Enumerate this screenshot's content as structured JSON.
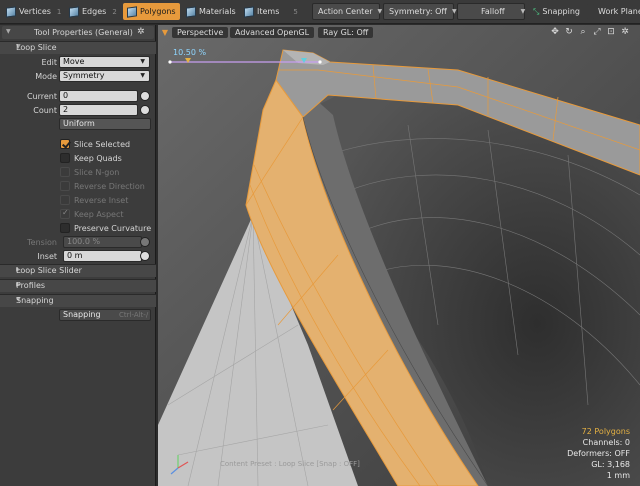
{
  "modes": [
    {
      "label": "Vertices",
      "num": "1"
    },
    {
      "label": "Edges",
      "num": "2"
    },
    {
      "label": "Polygons",
      "num": ""
    },
    {
      "label": "Materials",
      "num": ""
    },
    {
      "label": "Items",
      "num": "5"
    }
  ],
  "toolbar": {
    "action_center": "Action Center",
    "symmetry": "Symmetry: Off",
    "falloff": "Falloff",
    "snapping": "Snapping",
    "work_plane": "Work Plane"
  },
  "panel": {
    "title": "Tool Properties (General)",
    "loop_slice": "Loop Slice",
    "edit_label": "Edit",
    "edit_value": "Move",
    "mode_label": "Mode",
    "mode_value": "Symmetry",
    "current_label": "Current",
    "current_value": "0",
    "count_label": "Count",
    "count_value": "2",
    "uniform": "Uniform",
    "slice_selected": "Slice Selected",
    "keep_quads": "Keep Quads",
    "slice_ngon": "Slice N-gon",
    "reverse_direction": "Reverse Direction",
    "reverse_inset": "Reverse Inset",
    "keep_aspect": "Keep Aspect",
    "preserve_curvature": "Preserve Curvature",
    "tension_label": "Tension",
    "tension_value": "100.0 %",
    "inset_label": "Inset",
    "inset_value": "0 m",
    "loop_slice_slider": "Loop Slice Slider",
    "profiles": "Profiles",
    "snapping": "Snapping",
    "snapping_btn": "Snapping",
    "snapping_shortcut": "Ctrl-Alt-/"
  },
  "viewport": {
    "perspective": "Perspective",
    "opengl": "Advanced OpenGL",
    "raygl": "Ray GL: Off",
    "percent": "10.50 %",
    "preset": "Content Preset : Loop Slice  [Snap : OFF]",
    "polygons": "72 Polygons",
    "channels": "Channels: 0",
    "deformers": "Deformers: OFF",
    "gl": "GL: 3,168",
    "unit": "1 mm"
  },
  "colors": {
    "accent": "#e79a3c",
    "selection": "#e4b16f"
  }
}
